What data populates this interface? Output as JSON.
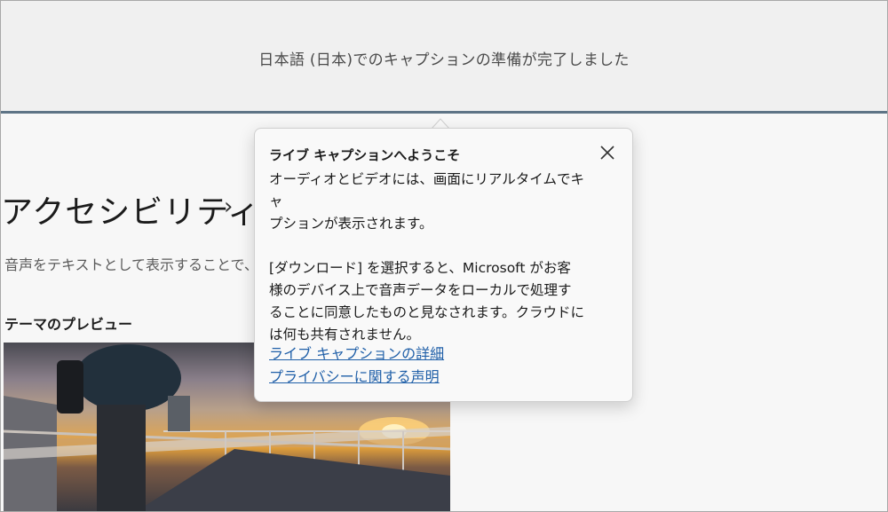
{
  "caption": {
    "text": "日本語 (日本)でのキャプションの準備が完了しました"
  },
  "settings": {
    "title": "アクセシビリティ",
    "chevron": "›",
    "description": "音声をテキストとして表示することで、サ",
    "preview_label": "テーマのプレビュー"
  },
  "flyout": {
    "title": "ライブ キャプションへようこそ",
    "body_line1": "オーディオとビデオには、画面にリアルタイムでキャ",
    "body_line2": "プションが表示されます。",
    "body_line3": "[ダウンロード] を選択すると、Microsoft がお客",
    "body_line4": "様のデバイス上で音声データをローカルで処理す",
    "body_line5": "ることに同意したものと見なされます。クラウドに",
    "body_line6": "は何も共有されません。",
    "link_details": "ライブ キャプションの詳細",
    "link_privacy": "プライバシーに関する声明",
    "close_icon": "close-icon"
  },
  "colors": {
    "link": "#1f5fa8",
    "divider": "#5e7486"
  }
}
